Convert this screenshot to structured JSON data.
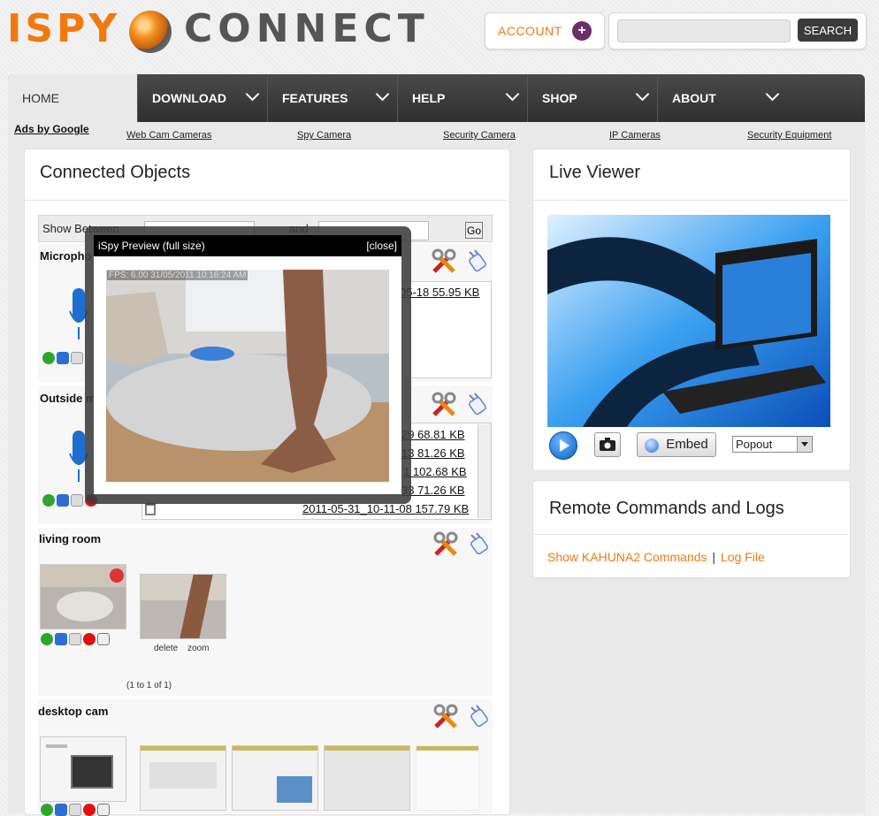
{
  "header": {
    "logo_left": "ISPY",
    "logo_right": "CONNECT",
    "account_label": "ACCOUNT",
    "account_plus": "+",
    "search_button": "SEARCH",
    "search_value": ""
  },
  "nav": {
    "items": [
      {
        "label": "HOME"
      },
      {
        "label": "DOWNLOAD"
      },
      {
        "label": "FEATURES"
      },
      {
        "label": "HELP"
      },
      {
        "label": "SHOP"
      },
      {
        "label": "ABOUT"
      }
    ]
  },
  "ads": {
    "title": "Ads by Google",
    "links": [
      "Web Cam Cameras",
      "Spy Camera",
      "Security Camera",
      "IP Cameras",
      "Security Equipment"
    ]
  },
  "connected": {
    "title": "Connected Objects",
    "filter_label": "Show Between",
    "filter_and": "and",
    "go_label": "Go",
    "sections": [
      {
        "title": "Micropho",
        "files": [
          "05-18   55.95 KB"
        ]
      },
      {
        "title": "Outside m",
        "files": [
          "29   68.81 KB",
          "13   81.26 KB",
          "1   102.68 KB",
          "33   71.26 KB",
          "2011-05-31_10-11-08   157.79 KB"
        ]
      },
      {
        "title": "living room",
        "delete_label": "delete",
        "zoom_label": "zoom",
        "pager": "(1 to 1 of 1)"
      },
      {
        "title": "desktop cam"
      }
    ]
  },
  "preview": {
    "title": "iSpy Preview (full size)",
    "close": "[close]",
    "fps": "FPS: 6.00 31/05/2011 10:16:24 AM"
  },
  "live_viewer": {
    "title": "Live Viewer",
    "embed_label": "Embed",
    "popout_value": "Popout"
  },
  "remote": {
    "title": "Remote Commands and Logs",
    "commands_link": "Show KAHUNA2 Commands",
    "separator": "|",
    "log_link": "Log File"
  },
  "colors": {
    "accent": "#f07a10",
    "nav_bg": "#3a3a3a"
  }
}
